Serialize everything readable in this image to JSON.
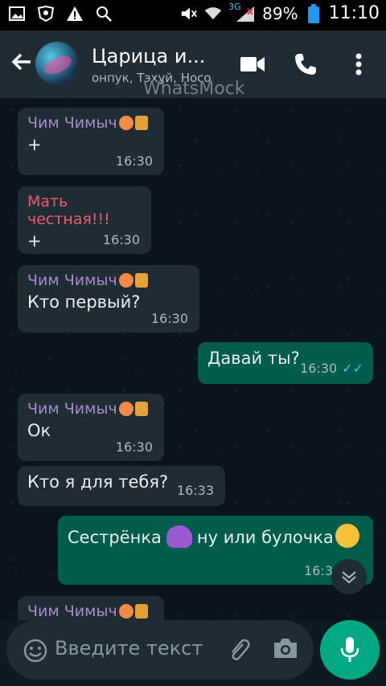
{
  "status_bar": {
    "signal_label": "3G",
    "battery": "89%",
    "time": "11:10"
  },
  "header": {
    "title": "Царица и...",
    "subtitle": "онпук, Тэхуй, Носо",
    "watermark": "WhatsMock"
  },
  "messages": [
    {
      "sender": "Чим Чимыч",
      "text": "+",
      "time": "16:30"
    },
    {
      "sender": "Мать честная!!!",
      "text": "+",
      "time": "16:30"
    },
    {
      "sender": "Чим Чимыч",
      "text": "Кто первый?",
      "time": "16:30"
    },
    {
      "text": "Давай ты?",
      "time": "16:30",
      "ticks": "✓✓"
    },
    {
      "sender": "Чим Чимыч",
      "text": "Ок",
      "time": "16:30"
    },
    {
      "text": "Кто я для тебя?",
      "time": "16:33"
    },
    {
      "text_before": "Сестрёнка",
      "text_after": "ну или булочка",
      "time": "16:3"
    },
    {
      "sender": "Чим Чимыч"
    }
  ],
  "input": {
    "placeholder": "Введите текст"
  },
  "colors": {
    "header_bg": "#1f2c33",
    "incoming_bubble": "#1f2c33",
    "outgoing_bubble": "#005c4b",
    "accent": "#00a884"
  }
}
